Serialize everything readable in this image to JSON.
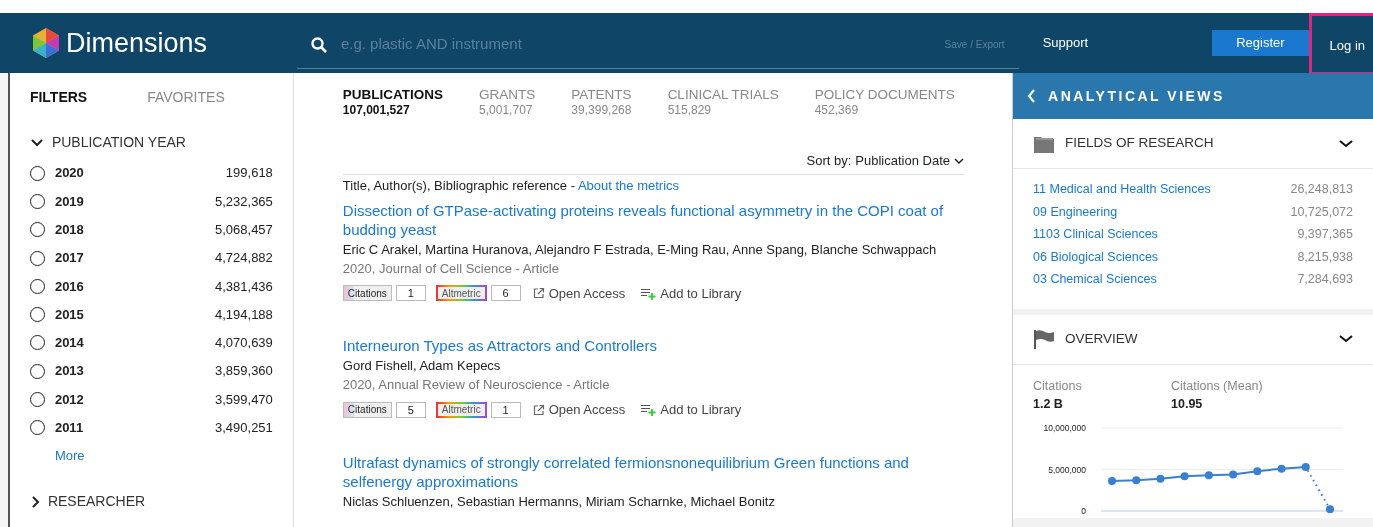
{
  "header": {
    "logo_text": "Dimensions",
    "search": {
      "placeholder": "e.g. plastic AND instrument"
    },
    "save_export": "Save / Export",
    "support": "Support",
    "register": "Register",
    "login": {
      "label": "Log in",
      "highlighted": true
    }
  },
  "sidebar": {
    "tabs": [
      {
        "label": "FILTERS",
        "selected": true
      },
      {
        "label": "FAVORITES",
        "selected": false
      }
    ],
    "facets": [
      {
        "title": "PUBLICATION YEAR",
        "expanded": true,
        "options": [
          {
            "label": "2020",
            "count": "199,618",
            "checked": false
          },
          {
            "label": "2019",
            "count": "5,232,365",
            "checked": false
          },
          {
            "label": "2018",
            "count": "5,068,457",
            "checked": false
          },
          {
            "label": "2017",
            "count": "4,724,882",
            "checked": false
          },
          {
            "label": "2016",
            "count": "4,381,436",
            "checked": false
          },
          {
            "label": "2015",
            "count": "4,194,188",
            "checked": false
          },
          {
            "label": "2014",
            "count": "4,070,639",
            "checked": false
          },
          {
            "label": "2013",
            "count": "3,859,360",
            "checked": false
          },
          {
            "label": "2012",
            "count": "3,599,470",
            "checked": false
          },
          {
            "label": "2011",
            "count": "3,490,251",
            "checked": false
          }
        ],
        "more": "More"
      },
      {
        "title": "RESEARCHER",
        "expanded": false
      }
    ]
  },
  "main": {
    "tabs": [
      {
        "label": "PUBLICATIONS",
        "count": "107,001,527",
        "selected": true
      },
      {
        "label": "GRANTS",
        "count": "5,001,707",
        "selected": false
      },
      {
        "label": "PATENTS",
        "count": "39,399,268",
        "selected": false
      },
      {
        "label": "CLINICAL TRIALS",
        "count": "515,829",
        "selected": false
      },
      {
        "label": "POLICY DOCUMENTS",
        "count": "452,369",
        "selected": false
      }
    ],
    "sort": {
      "label": "Sort by:",
      "value": "Publication Date"
    },
    "list_header": "Title, Author(s), Bibliographic reference - ",
    "about_link": "About the metrics",
    "results": [
      {
        "title": "Dissection of GTPase-activating proteins reveals functional asymmetry in the COPI coat of budding yeast",
        "authors": "Eric C Arakel, Martina Huranova, Alejandro F Estrada, E-Ming Rau, Anne Spang, Blanche Schwappach",
        "source": "2020, Journal of Cell Science - Article",
        "citations_label": "Citations",
        "citations": "1",
        "altmetric_label": "Altmetric",
        "altmetric": "6",
        "open_access": "Open Access",
        "add_to_library": "Add to Library"
      },
      {
        "title": "Interneuron Types as Attractors and Controllers",
        "authors": "Gord Fishell, Adam Kepecs",
        "source": "2020, Annual Review of Neuroscience - Article",
        "citations_label": "Citations",
        "citations": "5",
        "altmetric_label": "Altmetric",
        "altmetric": "1",
        "open_access": "Open Access",
        "add_to_library": "Add to Library"
      },
      {
        "title": "Ultrafast dynamics of strongly correlated fermionsnonequilibrium Green functions and selfenergy approximations",
        "authors": "Niclas Schluenzen, Sebastian Hermanns, Miriam Scharnke, Michael Bonitz"
      }
    ]
  },
  "analytics": {
    "title": "ANALYTICAL VIEWS",
    "fields": {
      "title": "FIELDS OF RESEARCH",
      "expanded": true,
      "items": [
        {
          "label": "11 Medical and Health Sciences",
          "count": "26,248,813"
        },
        {
          "label": "09 Engineering",
          "count": "10,725,072"
        },
        {
          "label": "1103 Clinical Sciences",
          "count": "9,397,365"
        },
        {
          "label": "06 Biological Sciences",
          "count": "8,215,938"
        },
        {
          "label": "03 Chemical Sciences",
          "count": "7,284,693"
        }
      ]
    },
    "overview": {
      "title": "OVERVIEW",
      "expanded": true,
      "stats": [
        {
          "label": "Citations",
          "value": "1.2 B"
        },
        {
          "label": "Citations (Mean)",
          "value": "10.95"
        }
      ],
      "chart_data": {
        "type": "line",
        "series": [
          {
            "color": "#3a7fd0",
            "line_style": "dotted_last",
            "marker": "circle",
            "values": [
              3600000,
              3700000,
              3900000,
              4200000,
              4300000,
              4400000,
              4800000,
              5100000,
              5300000,
              200000
            ]
          }
        ],
        "ylim": [
          0,
          10000000
        ],
        "yticks": [
          {
            "value": 0,
            "label": "0"
          },
          {
            "value": 5000000,
            "label": "5,000,000"
          },
          {
            "value": 10000000,
            "label": "10,000,000"
          }
        ]
      }
    }
  }
}
